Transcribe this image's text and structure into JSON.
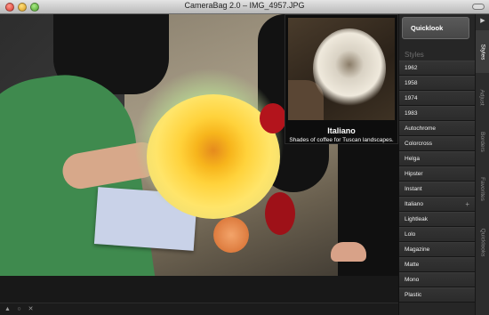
{
  "window": {
    "title": "CameraBag 2.0 – IMG_4957.JPG"
  },
  "popover": {
    "name": "Italiano",
    "description": "Shades of coffee for Tuscan landscapes."
  },
  "panel": {
    "quicklook_label": "Quicklook",
    "styles_heading": "Styles",
    "styles": [
      {
        "label": "1962"
      },
      {
        "label": "1958"
      },
      {
        "label": "1974"
      },
      {
        "label": "1983"
      },
      {
        "label": "Autochrome"
      },
      {
        "label": "Colorcross"
      },
      {
        "label": "Helga"
      },
      {
        "label": "Hipster"
      },
      {
        "label": "Instant"
      },
      {
        "label": "Italiano",
        "plus": "+"
      },
      {
        "label": "Lightleak"
      },
      {
        "label": "Lolo"
      },
      {
        "label": "Magazine"
      },
      {
        "label": "Matte"
      },
      {
        "label": "Mono"
      },
      {
        "label": "Plastic"
      }
    ]
  },
  "tabs": [
    {
      "label": "Styles",
      "active": true
    },
    {
      "label": "Adjust"
    },
    {
      "label": "Borders"
    },
    {
      "label": "Favorites"
    },
    {
      "label": "Quicklooks"
    }
  ],
  "bottombar": {
    "icons": [
      "triangle-up-icon",
      "circle-icon",
      "close-icon"
    ]
  }
}
